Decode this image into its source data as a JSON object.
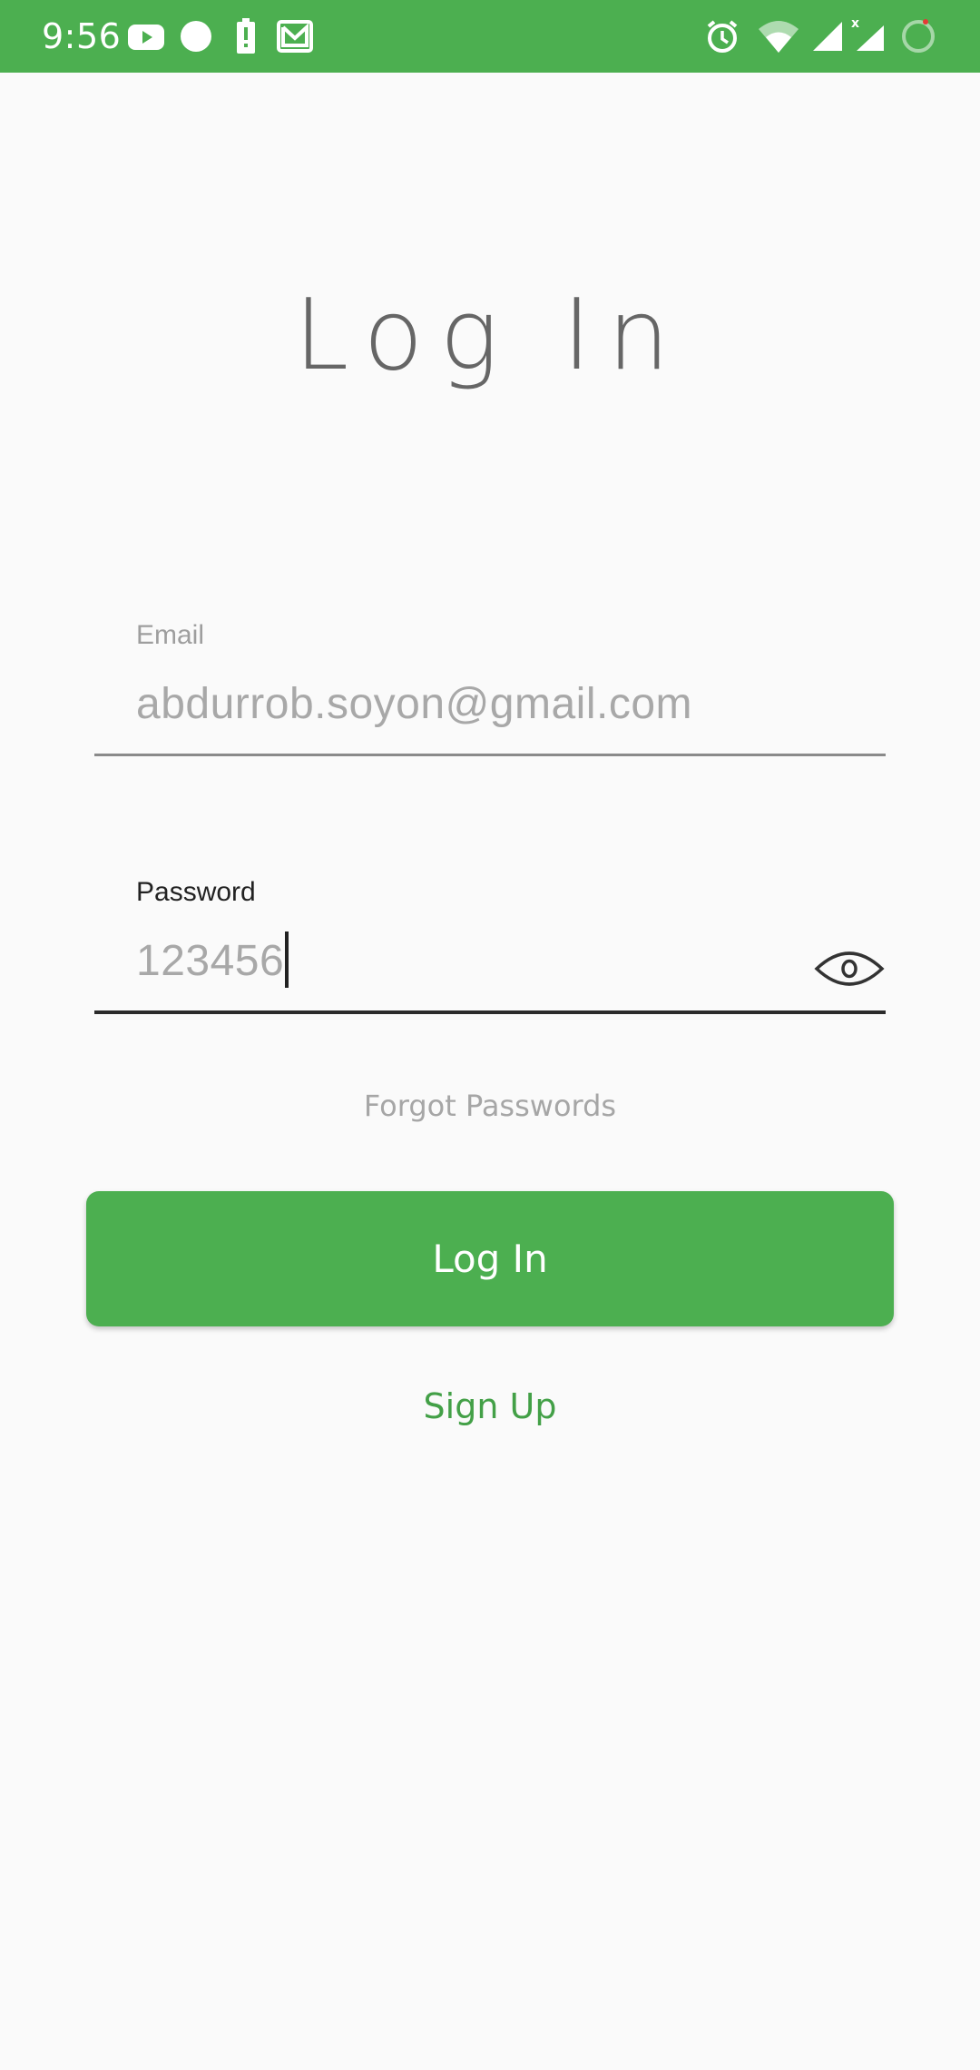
{
  "status_bar": {
    "time": "9:56",
    "background_color": "#4caf50",
    "left_icons": [
      "youtube-icon",
      "circle-notification-icon",
      "battery-alert-icon",
      "gmail-icon"
    ],
    "right_icons": [
      "alarm-icon",
      "wifi-icon",
      "signal-icon",
      "signal-no-data-icon",
      "loading-ring-icon"
    ]
  },
  "page": {
    "title": "Log In"
  },
  "form": {
    "email": {
      "label": "Email",
      "value": "abdurrob.soyon@gmail.com"
    },
    "password": {
      "label": "Password",
      "value": "123456",
      "toggle_icon": "eye-icon"
    },
    "forgot_label": "Forgot Passwords",
    "login_label": "Log In",
    "signup_label": "Sign Up"
  },
  "colors": {
    "accent": "#4caf50",
    "link_green": "#43a047",
    "background": "#fafafa"
  }
}
